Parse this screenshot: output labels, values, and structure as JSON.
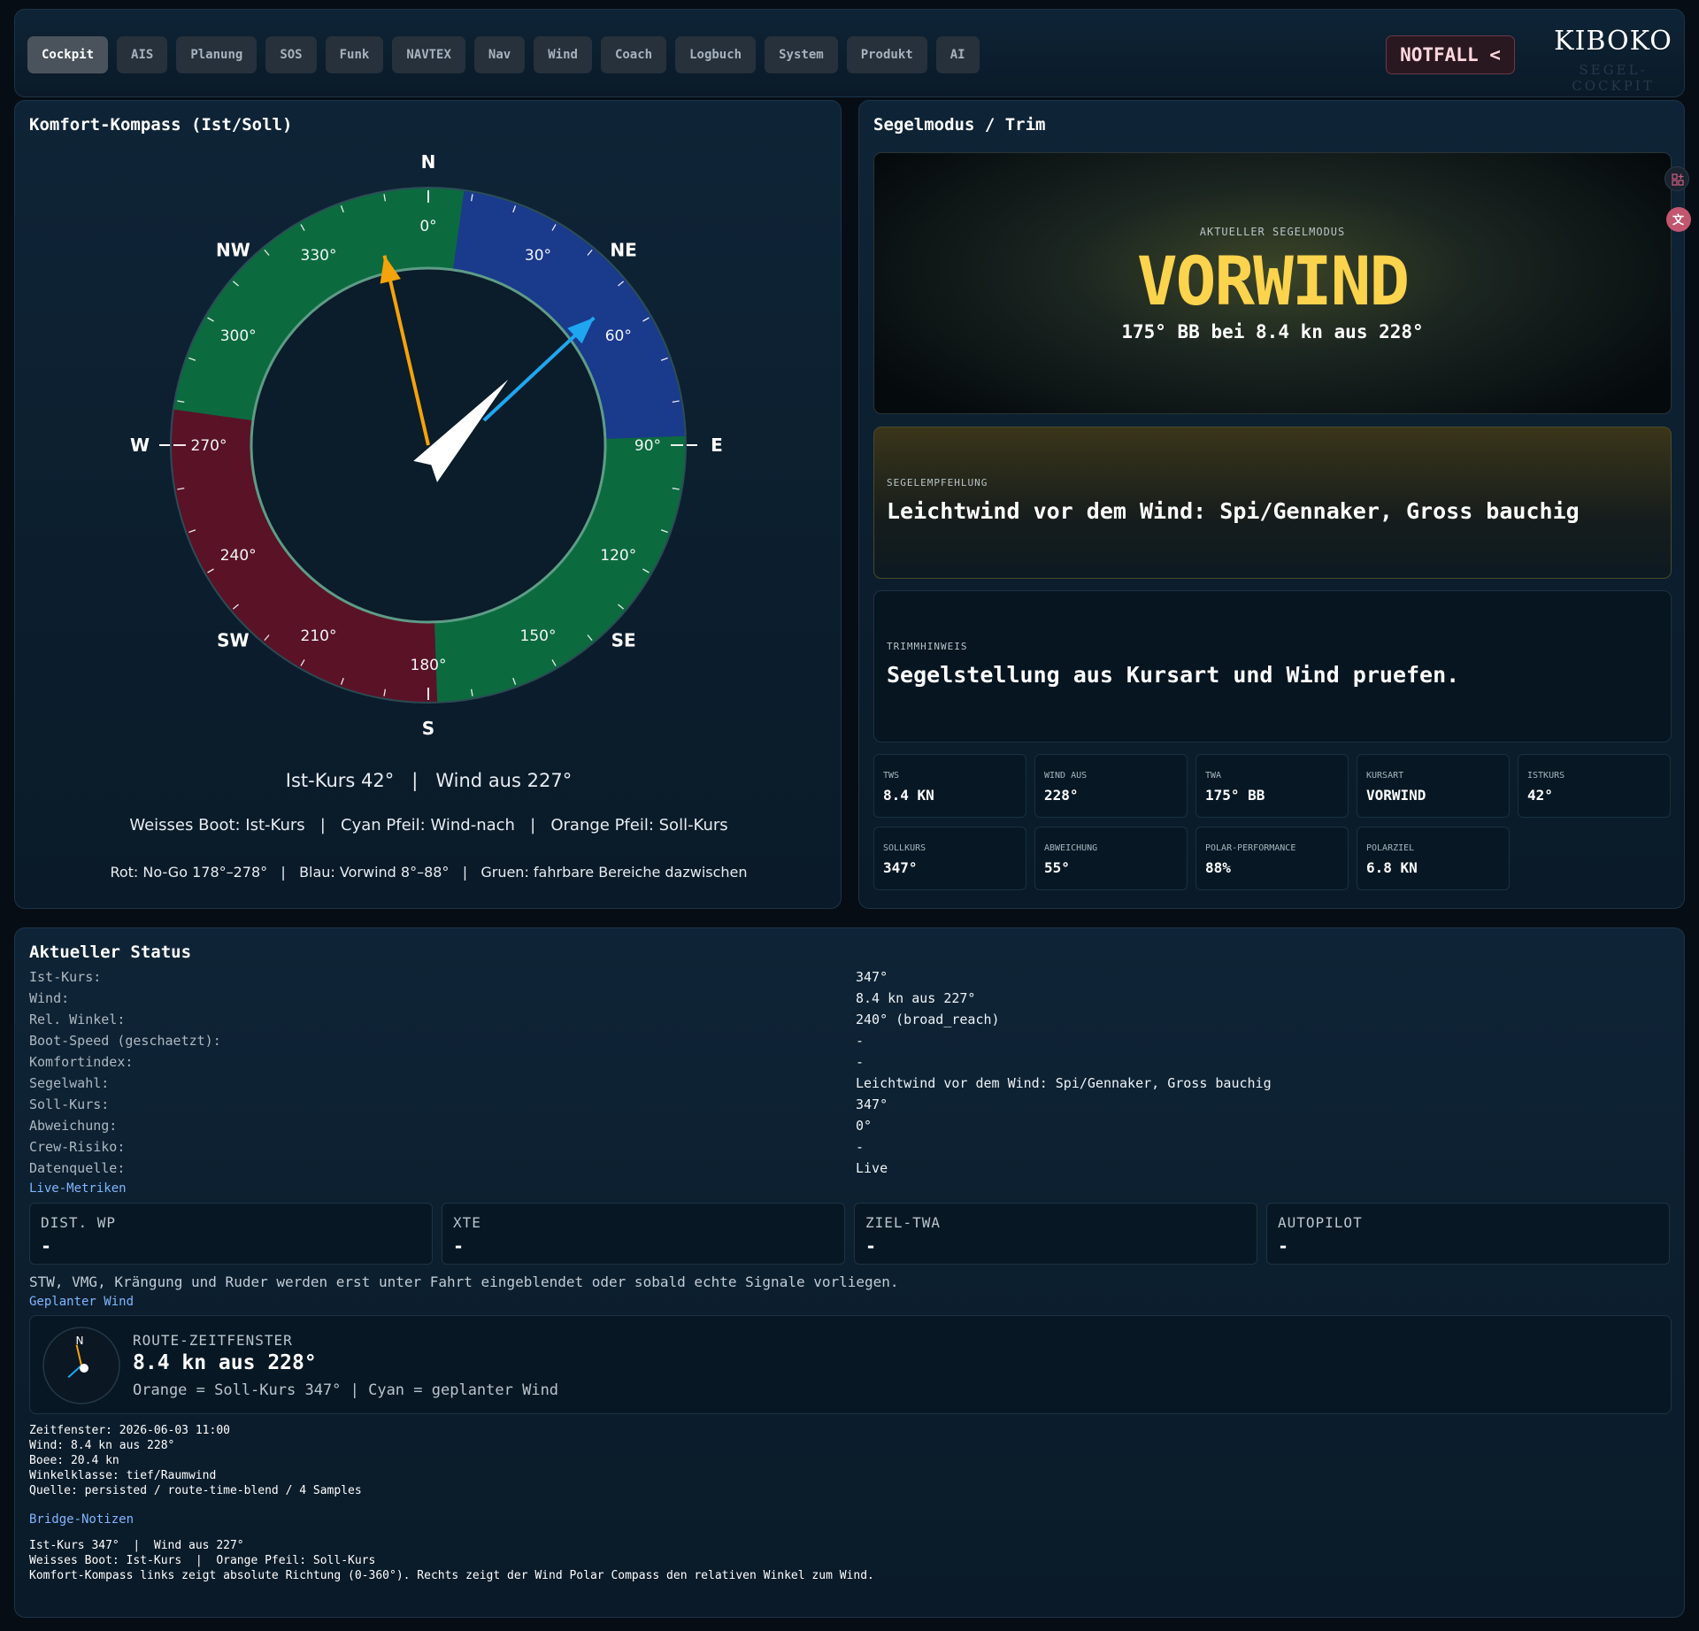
{
  "nav": {
    "tabs": [
      "Cockpit",
      "AIS",
      "Planung",
      "SOS",
      "Funk",
      "NAVTEX",
      "Nav",
      "Wind",
      "Coach",
      "Logbuch",
      "System",
      "Produkt",
      "AI"
    ],
    "active_tab": "Cockpit",
    "notfall_label": "NOTFALL <",
    "logo_text": "KIBOKO",
    "logo_subtitle": "SEGEL-COCKPIT"
  },
  "compass": {
    "title": "Komfort-Kompass (Ist/Soll)",
    "cardinals": {
      "n": "N",
      "ne": "NE",
      "e": "E",
      "se": "SE",
      "s": "S",
      "sw": "SW",
      "w": "W",
      "nw": "NW"
    },
    "degree_labels": [
      "0°",
      "30°",
      "60°",
      "90°",
      "120°",
      "150°",
      "180°",
      "210°",
      "240°",
      "270°",
      "300°",
      "330°"
    ],
    "ist_kurs_deg": 42,
    "soll_kurs_deg": 347,
    "wind_to_deg": 47,
    "nogo_range": [
      178,
      278
    ],
    "vorwind_range": [
      8,
      88
    ],
    "colors": {
      "nogo": "#5a1227",
      "vorwind": "#1a3a8c",
      "fahrbar": "#0b6b3f",
      "boat": "#ffffff",
      "wind_arrow": "#1ea7f0",
      "soll_arrow": "#f5a30a"
    },
    "summary": "Ist-Kurs 42°   |   Wind aus 227°",
    "legend": "Weisses Boot: Ist-Kurs   |   Cyan Pfeil: Wind-nach   |   Orange Pfeil: Soll-Kurs",
    "ranges_legend": "Rot: No-Go 178°–278°   |   Blau: Vorwind 8°–88°   |   Gruen: fahrbare Bereiche dazwischen"
  },
  "sail": {
    "title": "Segelmodus / Trim",
    "mode_label": "AKTUELLER SEGELMODUS",
    "mode_value": "VORWIND",
    "mode_detail": "175°  BB bei 8.4 kn aus 228°",
    "rec_label": "SEGELEMPFEHLUNG",
    "rec_text": "Leichtwind vor dem Wind: Spi/Gennaker, Gross bauchig",
    "trim_label": "TRIMMHINWEIS",
    "trim_text": "Segelstellung aus Kursart und Wind pruefen.",
    "tiles": [
      {
        "label": "TWS",
        "value": "8.4 KN"
      },
      {
        "label": "WIND AUS",
        "value": "228°"
      },
      {
        "label": "TWA",
        "value": "175° BB"
      },
      {
        "label": "KURSART",
        "value": "VORWIND"
      },
      {
        "label": "ISTKURS",
        "value": "42°"
      },
      {
        "label": "SOLLKURS",
        "value": "347°"
      },
      {
        "label": "ABWEICHUNG",
        "value": "55°"
      },
      {
        "label": "POLAR-PERFORMANCE",
        "value": "88%"
      },
      {
        "label": "POLARZIEL",
        "value": "6.8 KN"
      }
    ]
  },
  "status": {
    "title": "Aktueller Status",
    "rows": [
      {
        "key": "Ist-Kurs:",
        "value": "347°"
      },
      {
        "key": "Wind:",
        "value": "8.4 kn aus 227°"
      },
      {
        "key": "Rel. Winkel:",
        "value": "240° (broad_reach)"
      },
      {
        "key": "Boot-Speed (geschaetzt):",
        "value": "-"
      },
      {
        "key": "Komfortindex:",
        "value": "-"
      },
      {
        "key": "Segelwahl:",
        "value": "Leichtwind vor dem Wind: Spi/Gennaker, Gross bauchig"
      },
      {
        "key": "Soll-Kurs:",
        "value": "347°"
      },
      {
        "key": "Abweichung:",
        "value": "0°"
      },
      {
        "key": "Crew-Risiko:",
        "value": "-"
      },
      {
        "key": "Datenquelle:",
        "value": "Live"
      }
    ],
    "live_link": "Live-Metriken",
    "metrics": [
      {
        "label": "DIST. WP",
        "value": "-"
      },
      {
        "label": "XTE",
        "value": "-"
      },
      {
        "label": "ZIEL-TWA",
        "value": "-"
      },
      {
        "label": "AUTOPILOT",
        "value": "-"
      }
    ],
    "hint": "STW, VMG, Krängung und Ruder werden erst unter Fahrt eingeblendet oder sobald echte Signale vorliegen.",
    "planned_link": "Geplanter Wind",
    "route": {
      "label": "ROUTE-ZEITFENSTER",
      "main": "8.4 kn aus 228°",
      "sub": "Orange = Soll-Kurs 347° | Cyan = geplanter Wind",
      "mini_n": "N"
    },
    "details": [
      "Zeitfenster: 2026-06-03 11:00",
      "Wind: 8.4 kn aus 228°",
      "Boee: 20.4 kn",
      "Winkelklasse: tief/Raumwind",
      "Quelle: persisted / route-time-blend / 4 Samples"
    ],
    "bridge_link": "Bridge-Notizen",
    "bridge_notes": [
      "Ist-Kurs 347°  |  Wind aus 227°",
      "Weisses Boot: Ist-Kurs  |  Orange Pfeil: Soll-Kurs",
      "Komfort-Kompass links zeigt absolute Richtung (0-360°). Rechts zeigt der Wind Polar Compass den relativen Winkel zum Wind."
    ]
  }
}
